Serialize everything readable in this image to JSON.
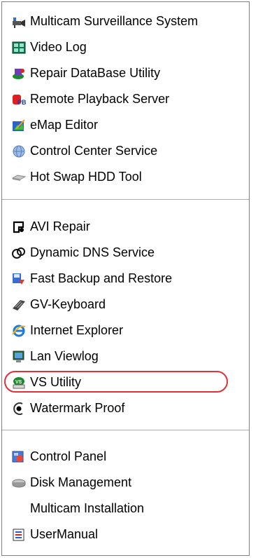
{
  "menu": {
    "items": [
      {
        "label": "Multicam Surveillance System",
        "icon": "surveillance-system-icon"
      },
      {
        "label": "Video Log",
        "icon": "video-log-icon"
      },
      {
        "label": "Repair DataBase Utility",
        "icon": "database-repair-icon"
      },
      {
        "label": "Remote Playback Server",
        "icon": "remote-playback-icon"
      },
      {
        "label": "eMap Editor",
        "icon": "emap-icon"
      },
      {
        "label": "Control Center Service",
        "icon": "globe-service-icon"
      },
      {
        "label": "Hot Swap HDD Tool",
        "icon": "hdd-icon"
      },
      {
        "label": "AVI Repair",
        "icon": "avi-repair-icon"
      },
      {
        "label": "Dynamic DNS Service",
        "icon": "dns-icon"
      },
      {
        "label": "Fast Backup and Restore",
        "icon": "backup-icon"
      },
      {
        "label": "GV-Keyboard",
        "icon": "keyboard-icon"
      },
      {
        "label": "Internet Explorer",
        "icon": "internet-explorer-icon"
      },
      {
        "label": "Lan Viewlog",
        "icon": "lan-viewlog-icon"
      },
      {
        "label": "VS Utility",
        "icon": "vs-utility-icon"
      },
      {
        "label": "Watermark Proof",
        "icon": "watermark-icon"
      },
      {
        "label": "Control Panel",
        "icon": "control-panel-icon"
      },
      {
        "label": "Disk Management",
        "icon": "disk-icon"
      },
      {
        "label": "Multicam Installation",
        "icon": ""
      },
      {
        "label": "UserManual",
        "icon": "user-manual-icon"
      }
    ],
    "highlighted_item": "VS Utility",
    "highlight_color": "#e0303a"
  }
}
